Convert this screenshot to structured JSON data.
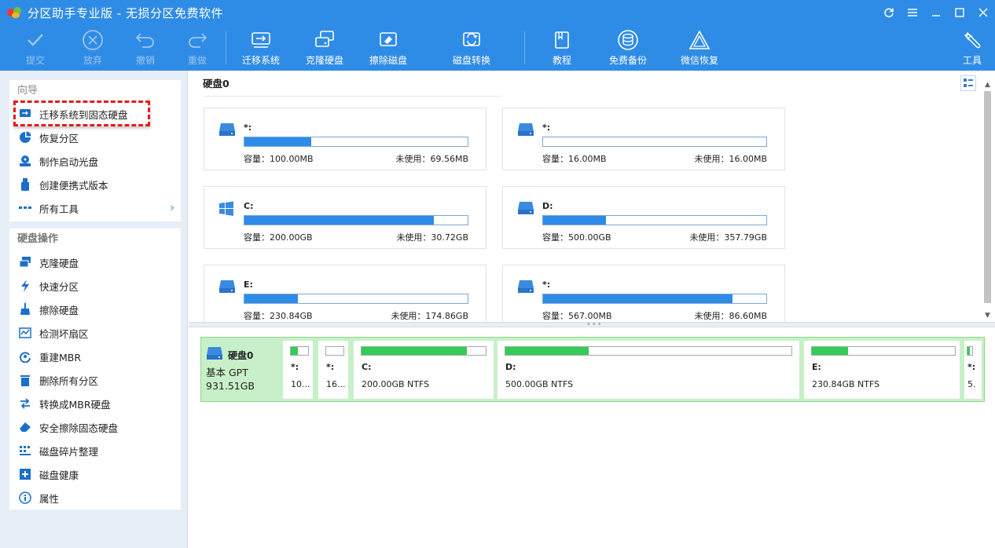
{
  "app": {
    "title": "分区助手专业版 - 无损分区免费软件"
  },
  "toolbar": {
    "commit": "提交",
    "discard": "放弃",
    "undo": "撤销",
    "redo": "重做",
    "migrate_os": "迁移系统",
    "clone_disk": "克隆硬盘",
    "wipe_disk": "擦除磁盘",
    "disk_convert": "磁盘转换",
    "tutorial": "教程",
    "free_backup": "免费备份",
    "wechat_recovery": "微信恢复",
    "tools": "工具"
  },
  "sidebar": {
    "wizard_title": "向导",
    "wizard_items": [
      {
        "label": "迁移系统到固态硬盘",
        "icon": "migrate-ssd-icon"
      },
      {
        "label": "恢复分区",
        "icon": "pie-recover-icon"
      },
      {
        "label": "制作启动光盘",
        "icon": "boot-disc-icon"
      },
      {
        "label": "创建便携式版本",
        "icon": "usb-portable-icon"
      },
      {
        "label": "所有工具",
        "icon": "more-dots-icon"
      }
    ],
    "disk_ops_title": "硬盘操作",
    "disk_ops_items": [
      {
        "label": "克隆硬盘",
        "icon": "clone-icon"
      },
      {
        "label": "快速分区",
        "icon": "lightning-icon"
      },
      {
        "label": "擦除硬盘",
        "icon": "broom-icon"
      },
      {
        "label": "检测坏扇区",
        "icon": "sector-check-icon"
      },
      {
        "label": "重建MBR",
        "icon": "rebuild-icon"
      },
      {
        "label": "删除所有分区",
        "icon": "trash-icon"
      },
      {
        "label": "转换成MBR硬盘",
        "icon": "convert-icon"
      },
      {
        "label": "安全擦除固态硬盘",
        "icon": "eraser-icon"
      },
      {
        "label": "磁盘碎片整理",
        "icon": "defrag-icon"
      },
      {
        "label": "磁盘健康",
        "icon": "health-plus-icon"
      },
      {
        "label": "属性",
        "icon": "info-icon"
      }
    ]
  },
  "main": {
    "disk_label": "硬盘0",
    "partitions": [
      {
        "name": "*:",
        "capacity": "容量：100.00MB",
        "free": "未使用：69.56MB",
        "used_fraction": 0.3,
        "icon": "drive-icon"
      },
      {
        "name": "*:",
        "capacity": "容量：16.00MB",
        "free": "未使用：16.00MB",
        "used_fraction": 0.0,
        "icon": "drive-icon"
      },
      {
        "name": "C:",
        "capacity": "容量：200.00GB",
        "free": "未使用：30.72GB",
        "used_fraction": 0.85,
        "icon": "windows-icon"
      },
      {
        "name": "D:",
        "capacity": "容量：500.00GB",
        "free": "未使用：357.79GB",
        "used_fraction": 0.28,
        "icon": "drive-icon"
      },
      {
        "name": "E:",
        "capacity": "容量：230.84GB",
        "free": "未使用：174.86GB",
        "used_fraction": 0.24,
        "icon": "drive-icon"
      },
      {
        "name": "*:",
        "capacity": "容量：567.00MB",
        "free": "未使用：86.60MB",
        "used_fraction": 0.85,
        "icon": "drive-icon"
      }
    ]
  },
  "disk_strip": {
    "name": "硬盘0",
    "type": "基本 GPT",
    "size": "931.51GB",
    "segments": [
      {
        "name": "*:",
        "info": "10...",
        "used_fraction": 0.4
      },
      {
        "name": "*:",
        "info": "16...",
        "used_fraction": 0.0
      },
      {
        "name": "C:",
        "info": "200.00GB NTFS",
        "used_fraction": 0.85
      },
      {
        "name": "D:",
        "info": "500.00GB NTFS",
        "used_fraction": 0.29
      },
      {
        "name": "E:",
        "info": "230.84GB NTFS",
        "used_fraction": 0.25
      },
      {
        "name": "*:",
        "info": "5.",
        "used_fraction": 0.5
      }
    ]
  }
}
